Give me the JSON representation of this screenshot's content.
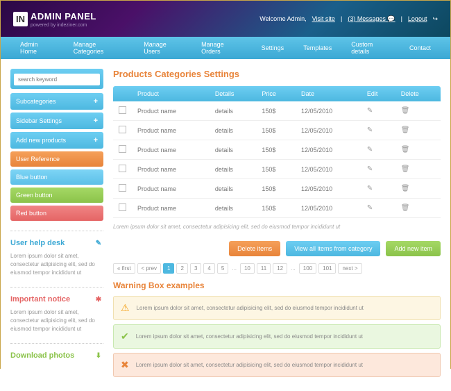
{
  "header": {
    "logo_badge": "IN",
    "logo_text": "ADMIN PANEL",
    "logo_sub": "powered by indeziner.com",
    "welcome_prefix": "Welcome Admin,",
    "visit_site": "Visit site",
    "messages_count": "(3)",
    "messages_label": "Messages",
    "logout": "Logout"
  },
  "topnav": [
    "Admin Home",
    "Manage Categories",
    "Manage Users",
    "Manage Orders",
    "Settings",
    "Templates",
    "Custom details",
    "Contact"
  ],
  "search": {
    "placeholder": "search keyword"
  },
  "sidebar_buttons": [
    {
      "label": "Subcategories",
      "cls": "btn-blue"
    },
    {
      "label": "Sidebar Settings",
      "cls": "btn-blue"
    },
    {
      "label": "Add new products",
      "cls": "btn-blue"
    },
    {
      "label": "User Reference",
      "cls": "btn-orange"
    },
    {
      "label": "Blue button",
      "cls": "btn-skyblue"
    },
    {
      "label": "Green button",
      "cls": "btn-green"
    },
    {
      "label": "Red button",
      "cls": "btn-red"
    }
  ],
  "help": [
    {
      "title": "User help desk",
      "cls": "ht-blue",
      "icon": "✎"
    },
    {
      "title": "Important notice",
      "cls": "ht-red",
      "icon": "✱"
    },
    {
      "title": "Download photos",
      "cls": "ht-green",
      "icon": "⬇"
    }
  ],
  "help_text": "Lorem ipsum dolor sit amet, consectetur adipisicing elit, sed do eiusmod tempor incididunt ut",
  "main": {
    "title": "Products Categories Settings",
    "columns": {
      "c1": "Product",
      "c2": "Details",
      "c3": "Price",
      "c4": "Date",
      "c5": "Edit",
      "c6": "Delete"
    },
    "row": {
      "product": "Product name",
      "details": "details",
      "price": "150$",
      "date": "12/05/2010"
    },
    "note": "Lorem ipsum dolor sit amet, consectetur adipisicing elit, sed do eiusmod tempor incididunt ut",
    "actions": {
      "a1": "Delete items",
      "a2": "View all items from category",
      "a3": "Add new item"
    },
    "pagination": {
      "first": "« first",
      "prev": "< prev",
      "p1": "1",
      "p2": "2",
      "p3": "3",
      "p4": "4",
      "p5": "5",
      "p10": "10",
      "p11": "11",
      "p12": "12",
      "p100": "100",
      "p101": "101",
      "next": "next >"
    },
    "warnings_title": "Warning Box examples",
    "warning_text": "Lorem ipsum dolor sit amet, consectetur adipisicing elit, sed do eiusmod tempor incididunt ut"
  }
}
